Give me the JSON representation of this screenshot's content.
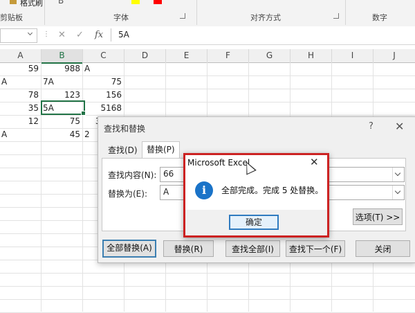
{
  "ribbon": {
    "format_painter_label": "格式刷",
    "groups": [
      "剪贴板",
      "字体",
      "对齐方式",
      "数字"
    ],
    "highlight_color": "#ffff00",
    "font_color": "#ff0000"
  },
  "formula_bar": {
    "cancel_symbol": "✕",
    "enter_symbol": "✓",
    "fx_label": "fx",
    "content": "5A"
  },
  "sheet": {
    "columns": [
      "A",
      "B",
      "C",
      "D",
      "E",
      "F",
      "G",
      "H",
      "I",
      "J"
    ],
    "selected_column": "B",
    "rows": [
      [
        "59",
        "988",
        "A"
      ],
      [
        "A",
        "7A",
        "75"
      ],
      [
        "78",
        "123",
        "156"
      ],
      [
        "35",
        "5A",
        "5168"
      ],
      [
        "12",
        "75",
        "33333"
      ],
      [
        "A",
        "45",
        "2"
      ]
    ]
  },
  "find_replace_dialog": {
    "title": "查找和替换",
    "help": "?",
    "close": "✕",
    "tabs": [
      "查找(D)",
      "替换(P)"
    ],
    "active_tab": "替换(P)",
    "find_label": "查找内容(N):",
    "find_value": "66",
    "replace_label": "替换为(E):",
    "replace_value": "A",
    "options_button": "选项(T) >>",
    "buttons": {
      "replace_all": "全部替换(A)",
      "replace": "替换(R)",
      "find_all": "查找全部(I)",
      "find_next": "查找下一个(F)",
      "close": "关闭"
    }
  },
  "message_box": {
    "title": "Microsoft Excel",
    "close": "✕",
    "icon": "info-icon",
    "icon_glyph": "i",
    "message": "全部完成。完成 5 处替换。",
    "ok_button": "确定",
    "highlight_color": "#cc2222"
  }
}
